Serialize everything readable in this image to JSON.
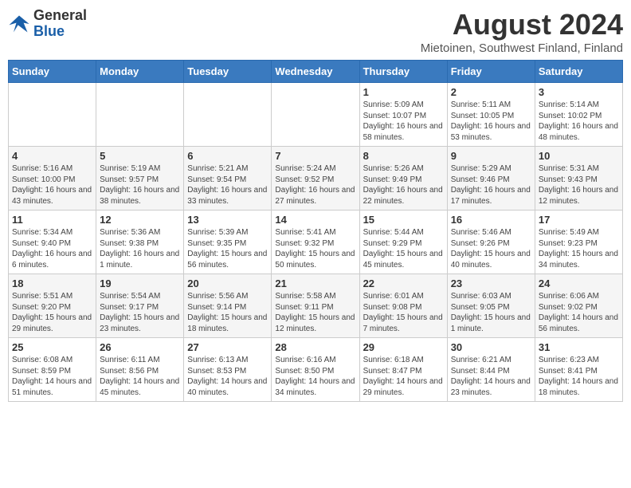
{
  "logo": {
    "general": "General",
    "blue": "Blue"
  },
  "title": "August 2024",
  "subtitle": "Mietoinen, Southwest Finland, Finland",
  "days_of_week": [
    "Sunday",
    "Monday",
    "Tuesday",
    "Wednesday",
    "Thursday",
    "Friday",
    "Saturday"
  ],
  "weeks": [
    [
      {
        "num": "",
        "info": ""
      },
      {
        "num": "",
        "info": ""
      },
      {
        "num": "",
        "info": ""
      },
      {
        "num": "",
        "info": ""
      },
      {
        "num": "1",
        "info": "Sunrise: 5:09 AM\nSunset: 10:07 PM\nDaylight: 16 hours and 58 minutes."
      },
      {
        "num": "2",
        "info": "Sunrise: 5:11 AM\nSunset: 10:05 PM\nDaylight: 16 hours and 53 minutes."
      },
      {
        "num": "3",
        "info": "Sunrise: 5:14 AM\nSunset: 10:02 PM\nDaylight: 16 hours and 48 minutes."
      }
    ],
    [
      {
        "num": "4",
        "info": "Sunrise: 5:16 AM\nSunset: 10:00 PM\nDaylight: 16 hours and 43 minutes."
      },
      {
        "num": "5",
        "info": "Sunrise: 5:19 AM\nSunset: 9:57 PM\nDaylight: 16 hours and 38 minutes."
      },
      {
        "num": "6",
        "info": "Sunrise: 5:21 AM\nSunset: 9:54 PM\nDaylight: 16 hours and 33 minutes."
      },
      {
        "num": "7",
        "info": "Sunrise: 5:24 AM\nSunset: 9:52 PM\nDaylight: 16 hours and 27 minutes."
      },
      {
        "num": "8",
        "info": "Sunrise: 5:26 AM\nSunset: 9:49 PM\nDaylight: 16 hours and 22 minutes."
      },
      {
        "num": "9",
        "info": "Sunrise: 5:29 AM\nSunset: 9:46 PM\nDaylight: 16 hours and 17 minutes."
      },
      {
        "num": "10",
        "info": "Sunrise: 5:31 AM\nSunset: 9:43 PM\nDaylight: 16 hours and 12 minutes."
      }
    ],
    [
      {
        "num": "11",
        "info": "Sunrise: 5:34 AM\nSunset: 9:40 PM\nDaylight: 16 hours and 6 minutes."
      },
      {
        "num": "12",
        "info": "Sunrise: 5:36 AM\nSunset: 9:38 PM\nDaylight: 16 hours and 1 minute."
      },
      {
        "num": "13",
        "info": "Sunrise: 5:39 AM\nSunset: 9:35 PM\nDaylight: 15 hours and 56 minutes."
      },
      {
        "num": "14",
        "info": "Sunrise: 5:41 AM\nSunset: 9:32 PM\nDaylight: 15 hours and 50 minutes."
      },
      {
        "num": "15",
        "info": "Sunrise: 5:44 AM\nSunset: 9:29 PM\nDaylight: 15 hours and 45 minutes."
      },
      {
        "num": "16",
        "info": "Sunrise: 5:46 AM\nSunset: 9:26 PM\nDaylight: 15 hours and 40 minutes."
      },
      {
        "num": "17",
        "info": "Sunrise: 5:49 AM\nSunset: 9:23 PM\nDaylight: 15 hours and 34 minutes."
      }
    ],
    [
      {
        "num": "18",
        "info": "Sunrise: 5:51 AM\nSunset: 9:20 PM\nDaylight: 15 hours and 29 minutes."
      },
      {
        "num": "19",
        "info": "Sunrise: 5:54 AM\nSunset: 9:17 PM\nDaylight: 15 hours and 23 minutes."
      },
      {
        "num": "20",
        "info": "Sunrise: 5:56 AM\nSunset: 9:14 PM\nDaylight: 15 hours and 18 minutes."
      },
      {
        "num": "21",
        "info": "Sunrise: 5:58 AM\nSunset: 9:11 PM\nDaylight: 15 hours and 12 minutes."
      },
      {
        "num": "22",
        "info": "Sunrise: 6:01 AM\nSunset: 9:08 PM\nDaylight: 15 hours and 7 minutes."
      },
      {
        "num": "23",
        "info": "Sunrise: 6:03 AM\nSunset: 9:05 PM\nDaylight: 15 hours and 1 minute."
      },
      {
        "num": "24",
        "info": "Sunrise: 6:06 AM\nSunset: 9:02 PM\nDaylight: 14 hours and 56 minutes."
      }
    ],
    [
      {
        "num": "25",
        "info": "Sunrise: 6:08 AM\nSunset: 8:59 PM\nDaylight: 14 hours and 51 minutes."
      },
      {
        "num": "26",
        "info": "Sunrise: 6:11 AM\nSunset: 8:56 PM\nDaylight: 14 hours and 45 minutes."
      },
      {
        "num": "27",
        "info": "Sunrise: 6:13 AM\nSunset: 8:53 PM\nDaylight: 14 hours and 40 minutes."
      },
      {
        "num": "28",
        "info": "Sunrise: 6:16 AM\nSunset: 8:50 PM\nDaylight: 14 hours and 34 minutes."
      },
      {
        "num": "29",
        "info": "Sunrise: 6:18 AM\nSunset: 8:47 PM\nDaylight: 14 hours and 29 minutes."
      },
      {
        "num": "30",
        "info": "Sunrise: 6:21 AM\nSunset: 8:44 PM\nDaylight: 14 hours and 23 minutes."
      },
      {
        "num": "31",
        "info": "Sunrise: 6:23 AM\nSunset: 8:41 PM\nDaylight: 14 hours and 18 minutes."
      }
    ]
  ]
}
